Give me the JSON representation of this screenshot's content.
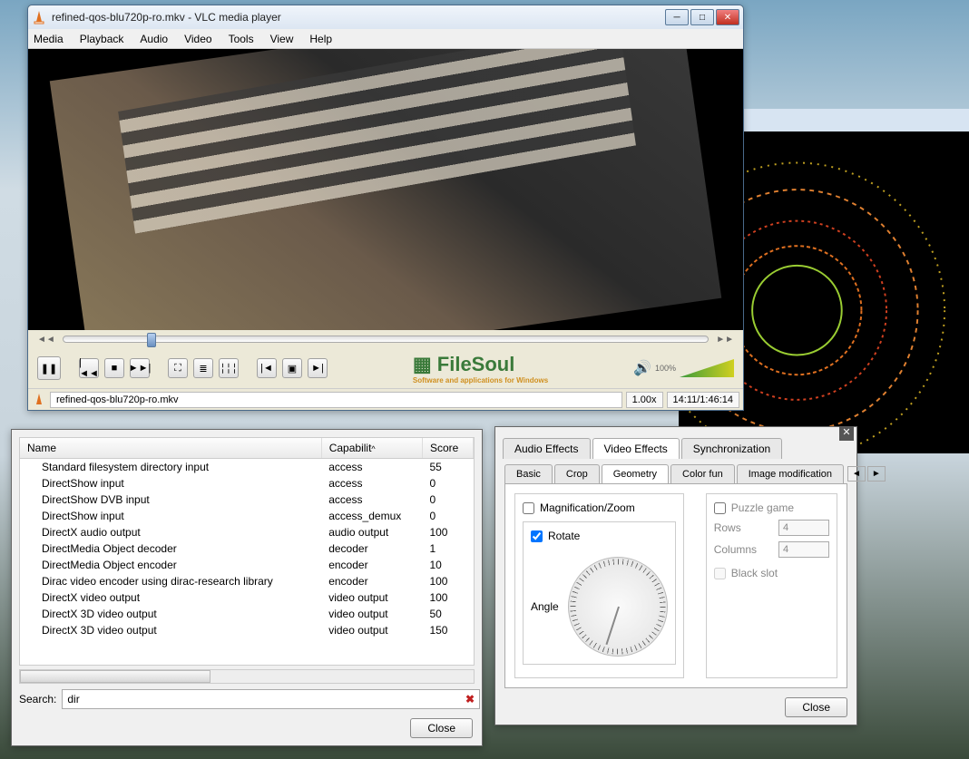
{
  "vlc": {
    "title": "refined-qos-blu720p-ro.mkv - VLC media player",
    "menu": [
      "Media",
      "Playback",
      "Audio",
      "Video",
      "Tools",
      "View",
      "Help"
    ],
    "volume_label": "100%",
    "status_file": "refined-qos-blu720p-ro.mkv",
    "speed": "1.00x",
    "time": "14:11/1:46:14",
    "watermark_main": "FileSoul",
    "watermark_sub": "Software and applications for Windows"
  },
  "plugins": {
    "columns": [
      "Name",
      "Capabilit",
      "Score"
    ],
    "rows": [
      {
        "name": "Standard filesystem directory input",
        "cap": "access",
        "score": "55"
      },
      {
        "name": "DirectShow input",
        "cap": "access",
        "score": "0"
      },
      {
        "name": "DirectShow DVB input",
        "cap": "access",
        "score": "0"
      },
      {
        "name": "DirectShow input",
        "cap": "access_demux",
        "score": "0"
      },
      {
        "name": "DirectX audio output",
        "cap": "audio output",
        "score": "100"
      },
      {
        "name": "DirectMedia Object decoder",
        "cap": "decoder",
        "score": "1"
      },
      {
        "name": "DirectMedia Object encoder",
        "cap": "encoder",
        "score": "10"
      },
      {
        "name": "Dirac video encoder using dirac-research library",
        "cap": "encoder",
        "score": "100"
      },
      {
        "name": "DirectX video output",
        "cap": "video output",
        "score": "100"
      },
      {
        "name": "DirectX 3D video output",
        "cap": "video output",
        "score": "50"
      },
      {
        "name": "DirectX 3D video output",
        "cap": "video output",
        "score": "150"
      }
    ],
    "search_label": "Search:",
    "search_value": "dir",
    "close": "Close"
  },
  "effects": {
    "tabs_top": [
      "Audio Effects",
      "Video Effects",
      "Synchronization"
    ],
    "active_top": "Video Effects",
    "tabs_sub": [
      "Basic",
      "Crop",
      "Geometry",
      "Color fun",
      "Image modification"
    ],
    "active_sub": "Geometry",
    "magzoom": "Magnification/Zoom",
    "rotate": "Rotate",
    "angle": "Angle",
    "puzzle": "Puzzle game",
    "rows_label": "Rows",
    "rows_value": "4",
    "cols_label": "Columns",
    "cols_value": "4",
    "black_slot": "Black slot",
    "close": "Close"
  }
}
